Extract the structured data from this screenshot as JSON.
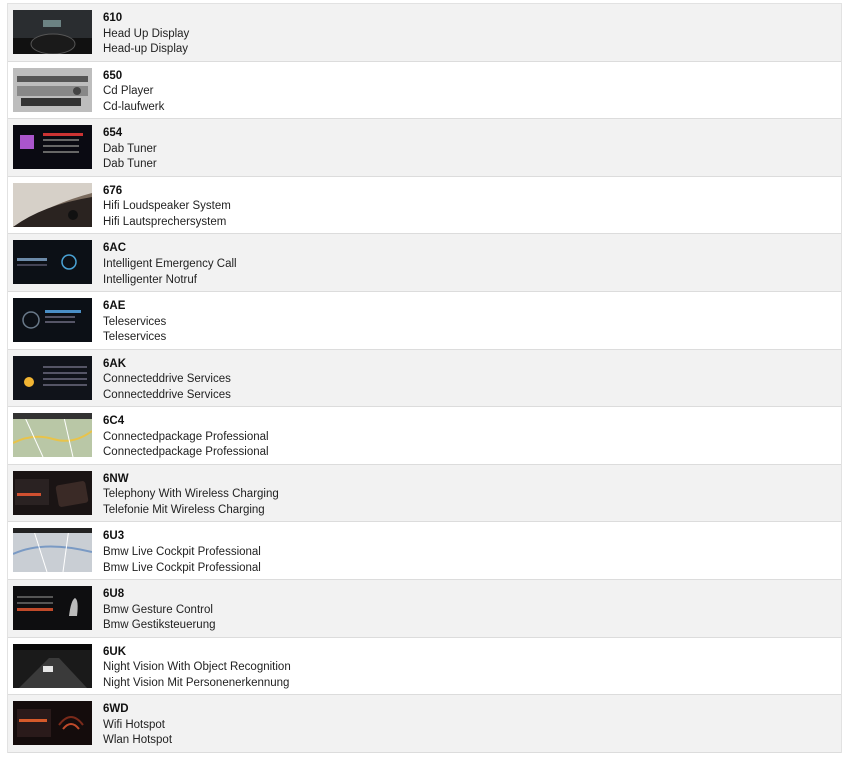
{
  "options": [
    {
      "code": "610",
      "name_en": "Head Up Display",
      "name_de": "Head-up Display",
      "thumb": "hud-icon"
    },
    {
      "code": "650",
      "name_en": "Cd Player",
      "name_de": "Cd-laufwerk",
      "thumb": "cd-player-icon"
    },
    {
      "code": "654",
      "name_en": "Dab Tuner",
      "name_de": "Dab Tuner",
      "thumb": "radio-screen-icon"
    },
    {
      "code": "676",
      "name_en": "Hifi Loudspeaker System",
      "name_de": "Hifi Lautsprechersystem",
      "thumb": "speaker-icon"
    },
    {
      "code": "6AC",
      "name_en": "Intelligent Emergency Call",
      "name_de": "Intelligenter Notruf",
      "thumb": "emergency-call-icon"
    },
    {
      "code": "6AE",
      "name_en": "Teleservices",
      "name_de": "Teleservices",
      "thumb": "teleservice-icon"
    },
    {
      "code": "6AK",
      "name_en": "Connecteddrive Services",
      "name_de": "Connecteddrive Services",
      "thumb": "weather-screen-icon"
    },
    {
      "code": "6C4",
      "name_en": "Connectedpackage Professional",
      "name_de": "Connectedpackage Professional",
      "thumb": "map-icon"
    },
    {
      "code": "6NW",
      "name_en": "Telephony With Wireless Charging",
      "name_de": "Telefonie Mit Wireless Charging",
      "thumb": "wireless-charging-icon"
    },
    {
      "code": "6U3",
      "name_en": "Bmw Live Cockpit Professional",
      "name_de": "Bmw Live Cockpit Professional",
      "thumb": "navigation-map-icon"
    },
    {
      "code": "6U8",
      "name_en": "Bmw Gesture Control",
      "name_de": "Bmw Gestiksteuerung",
      "thumb": "gesture-control-icon"
    },
    {
      "code": "6UK",
      "name_en": "Night Vision With Object Recognition",
      "name_de": "Night Vision Mit Personenerkennung",
      "thumb": "night-vision-icon"
    },
    {
      "code": "6WD",
      "name_en": "Wifi Hotspot",
      "name_de": "Wlan Hotspot",
      "thumb": "wifi-hotspot-icon"
    }
  ]
}
